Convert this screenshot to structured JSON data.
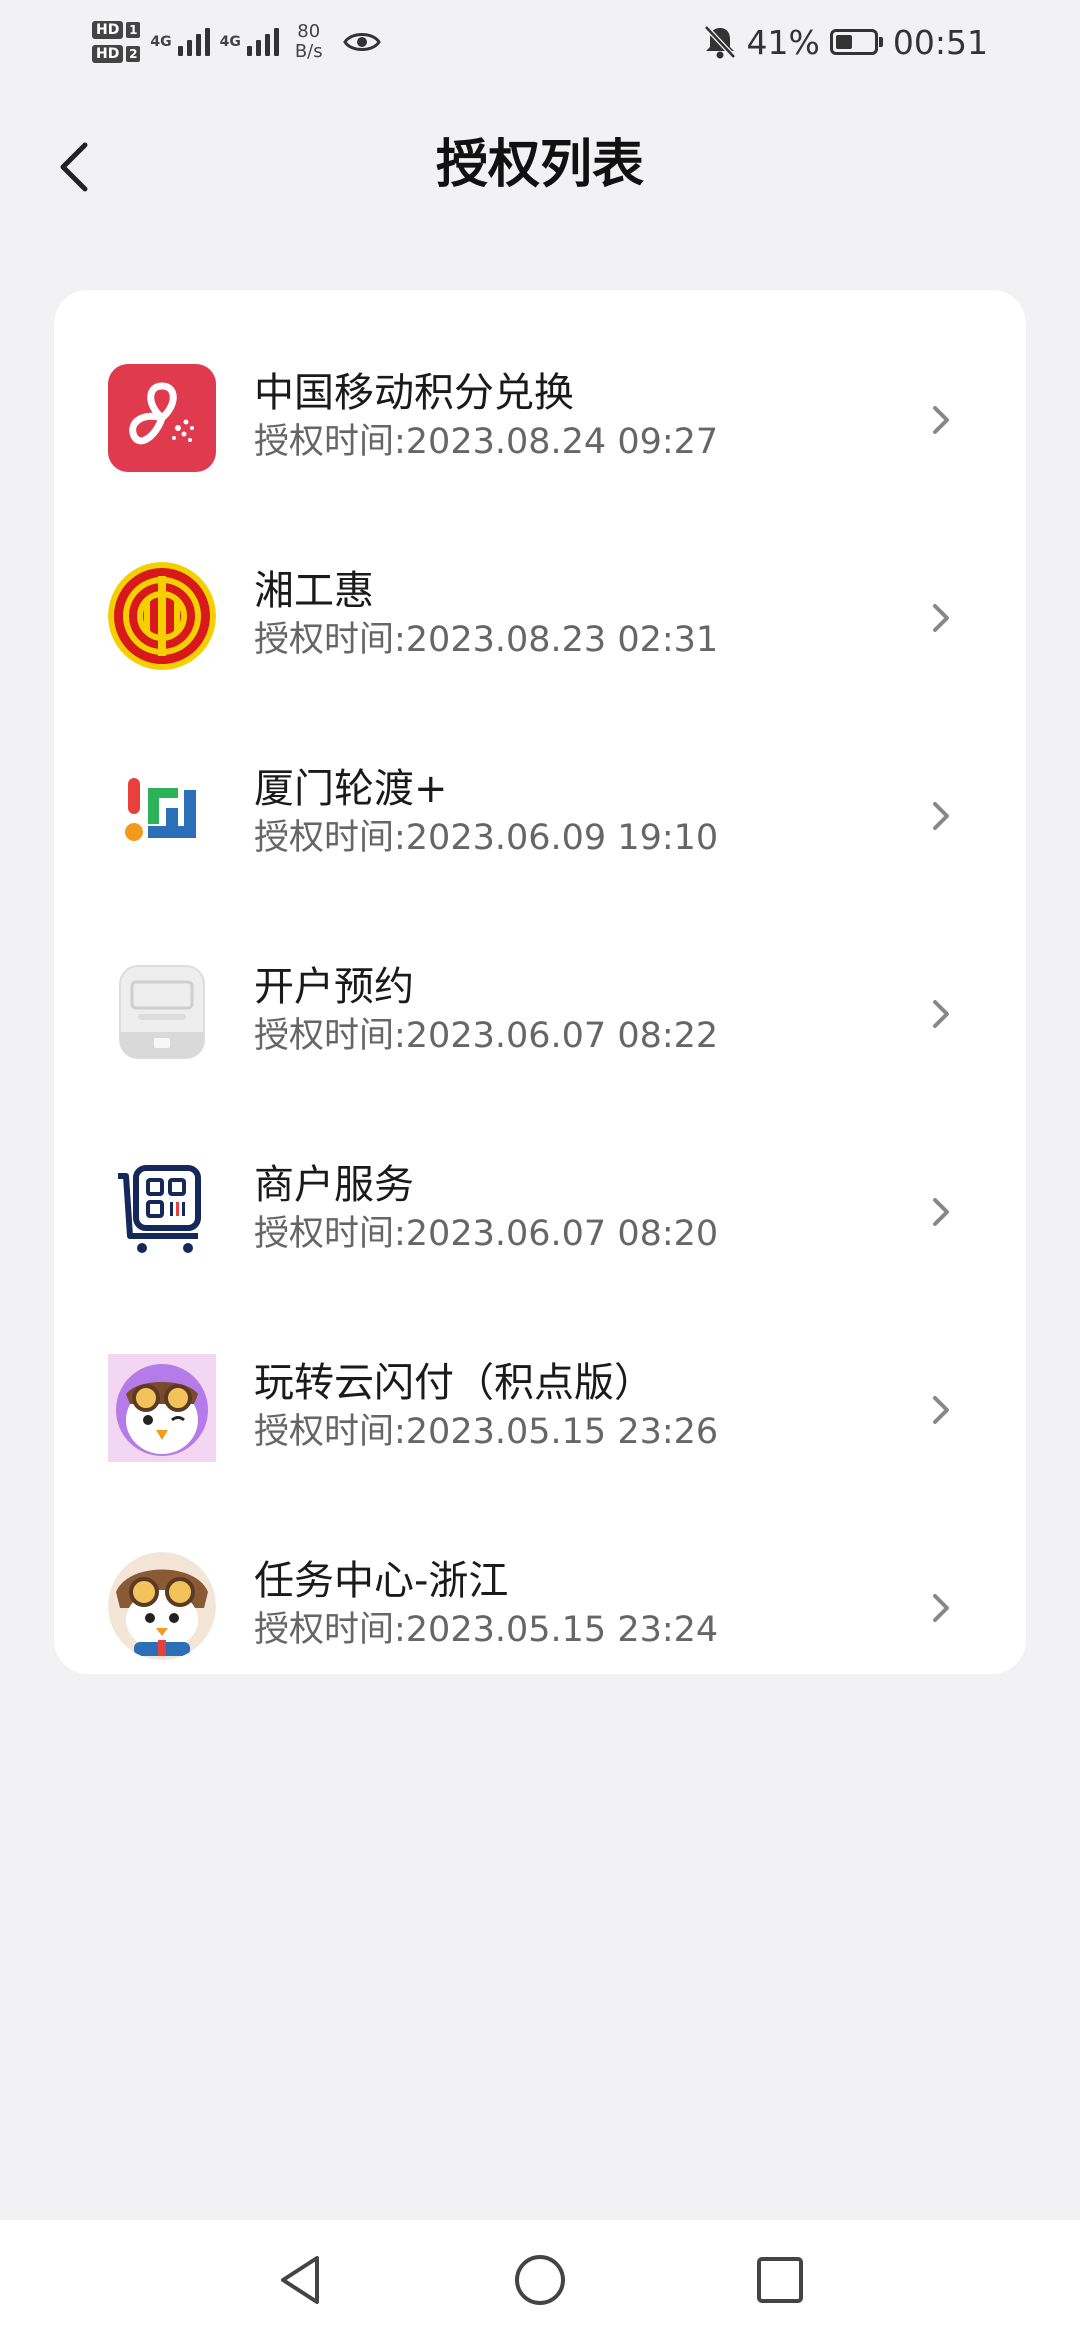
{
  "status_bar": {
    "network_type_1": "4G",
    "network_type_2": "4G",
    "speed_value": "80",
    "speed_unit": "B/s",
    "battery": "41%",
    "time": "00:51"
  },
  "header": {
    "title": "授权列表"
  },
  "authorizations": [
    {
      "name": "中国移动积分兑换",
      "time": "授权时间:2023.08.24 09:27",
      "icon": "china-mobile-points-icon"
    },
    {
      "name": "湘工惠",
      "time": "授权时间:2023.08.23 02:31",
      "icon": "xiang-gong-hui-icon"
    },
    {
      "name": "厦门轮渡+",
      "time": "授权时间:2023.06.09 19:10",
      "icon": "xiamen-ferry-icon"
    },
    {
      "name": "开户预约",
      "time": "授权时间:2023.06.07 08:22",
      "icon": "account-appointment-icon"
    },
    {
      "name": "商户服务",
      "time": "授权时间:2023.06.07 08:20",
      "icon": "merchant-service-icon"
    },
    {
      "name": "玩转云闪付（积点版）",
      "time": "授权时间:2023.05.15 23:26",
      "icon": "cloud-quickpass-points-icon"
    },
    {
      "name": "任务中心-浙江",
      "time": "授权时间:2023.05.15 23:24",
      "icon": "task-center-zhejiang-icon"
    }
  ],
  "colors": {
    "background": "#f2f2f4",
    "card": "#ffffff",
    "china_mobile_red": "#e03a4f",
    "union_red": "#d8181b",
    "union_yellow": "#f5d000"
  }
}
